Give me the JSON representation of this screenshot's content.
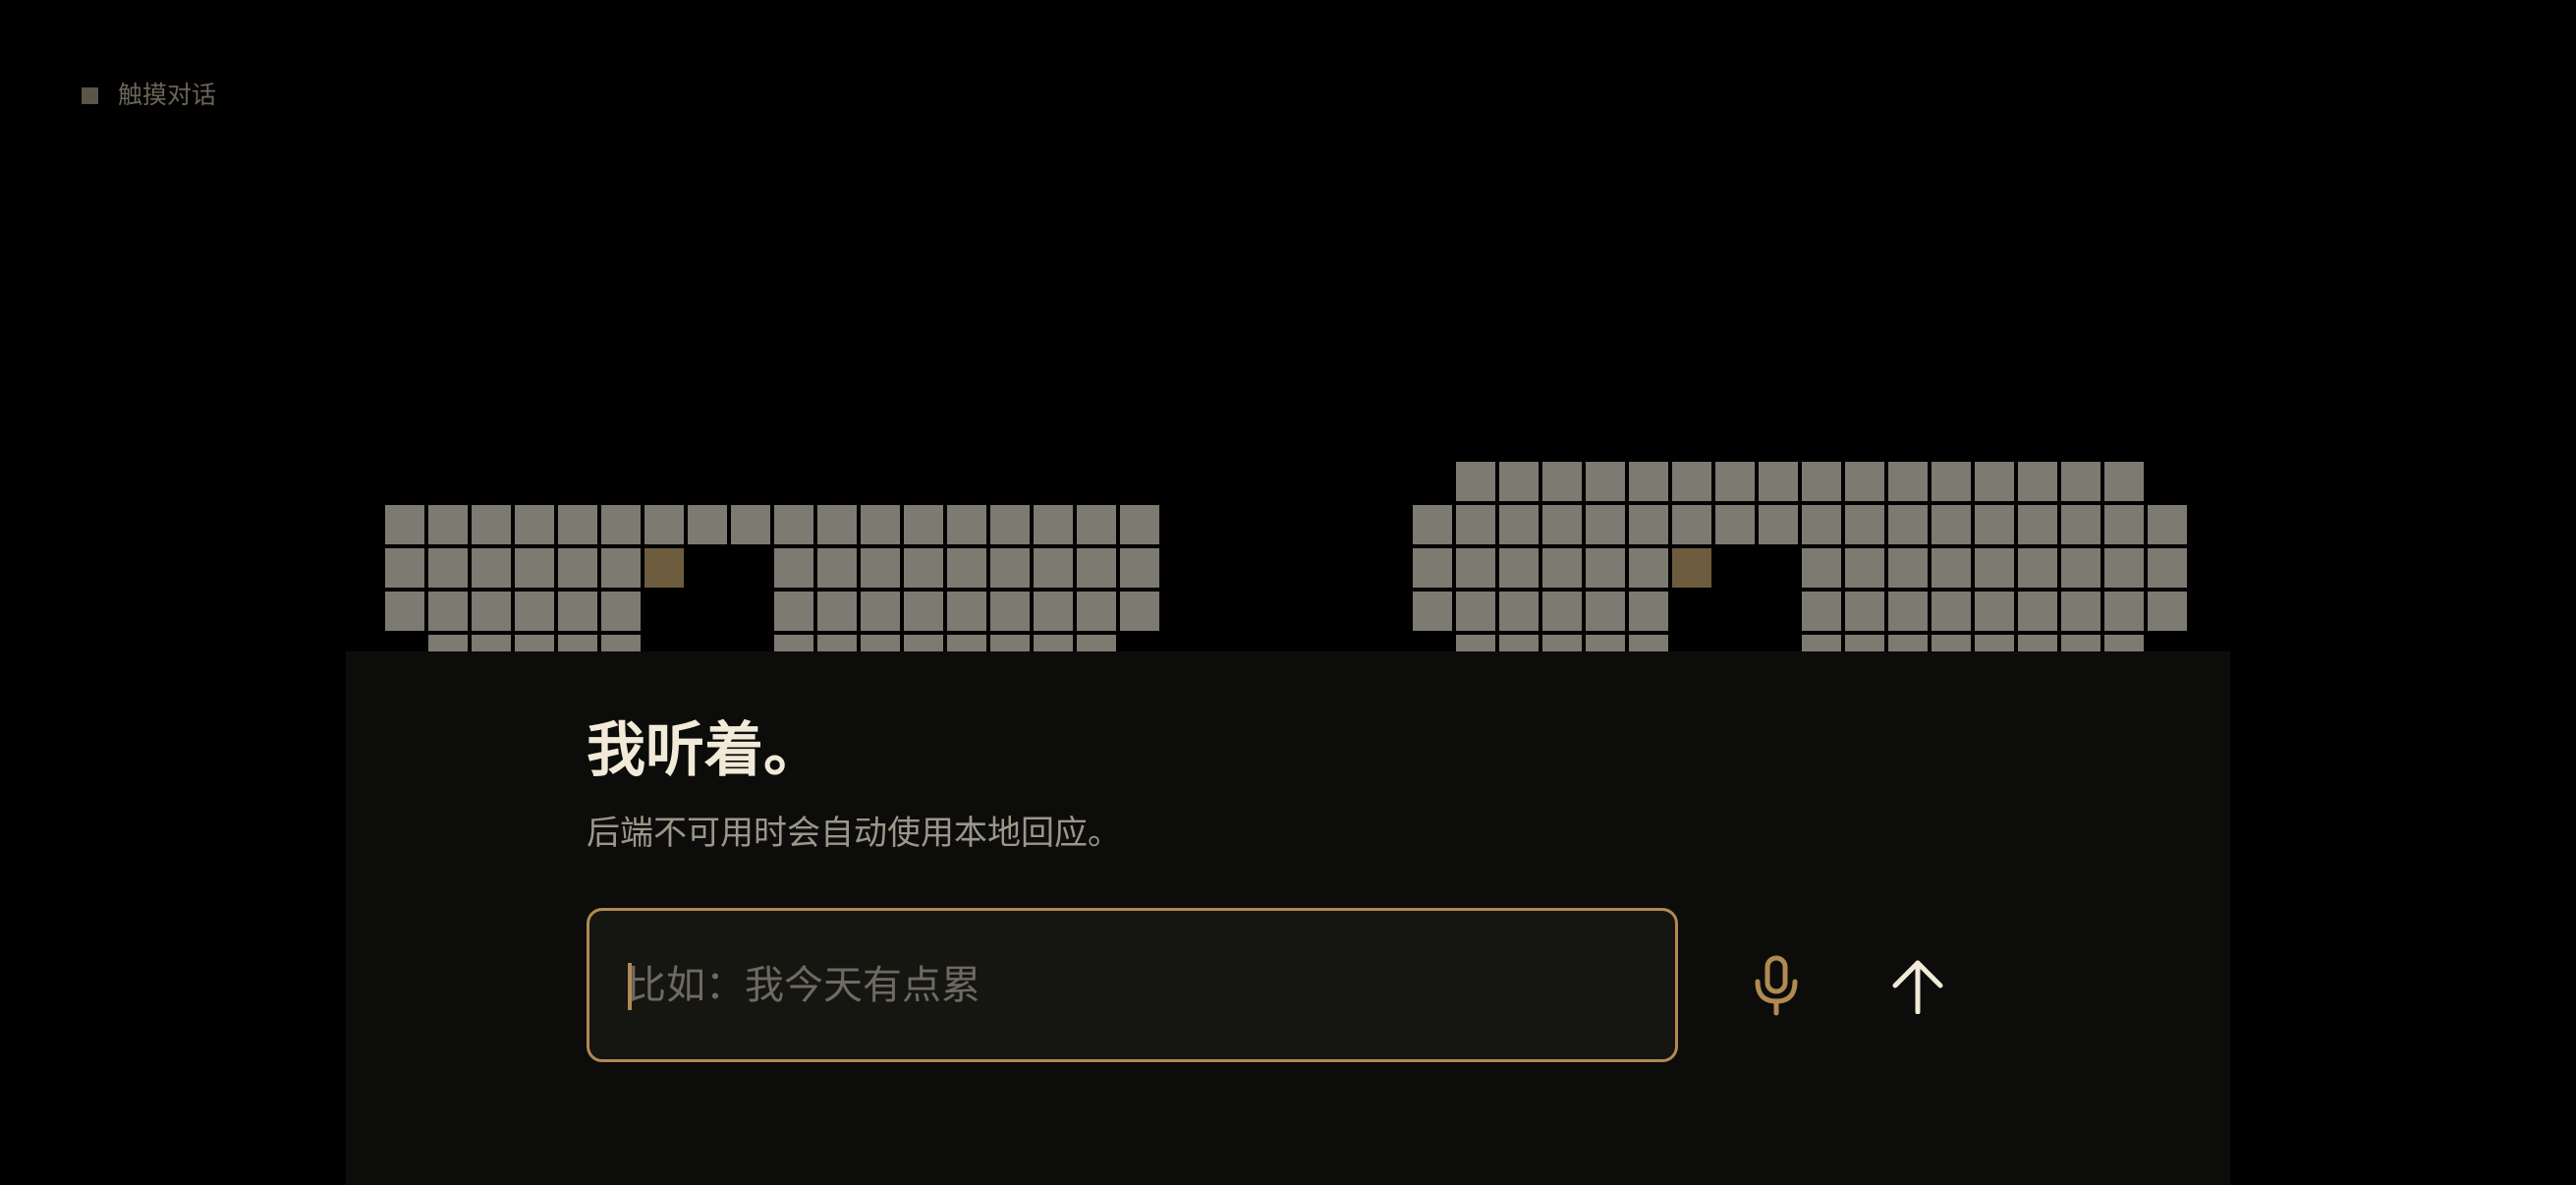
{
  "mode": {
    "label": "触摸对话"
  },
  "panel": {
    "heading": "我听着。",
    "subtext": "后端不可用时会自动使用本地回应。"
  },
  "input": {
    "placeholder": "比如：我今天有点累",
    "value": ""
  },
  "buttons": {
    "mic_icon": "microphone-icon",
    "send_icon": "arrow-up-icon"
  },
  "colors": {
    "background": "#000000",
    "panel": "#0c0c0b",
    "accent": "#b08a52",
    "grid_cell": "#7d7a72",
    "grid_accent_cell": "#6e5c3f",
    "heading": "#f2ead8",
    "muted_text": "#9c968a"
  }
}
